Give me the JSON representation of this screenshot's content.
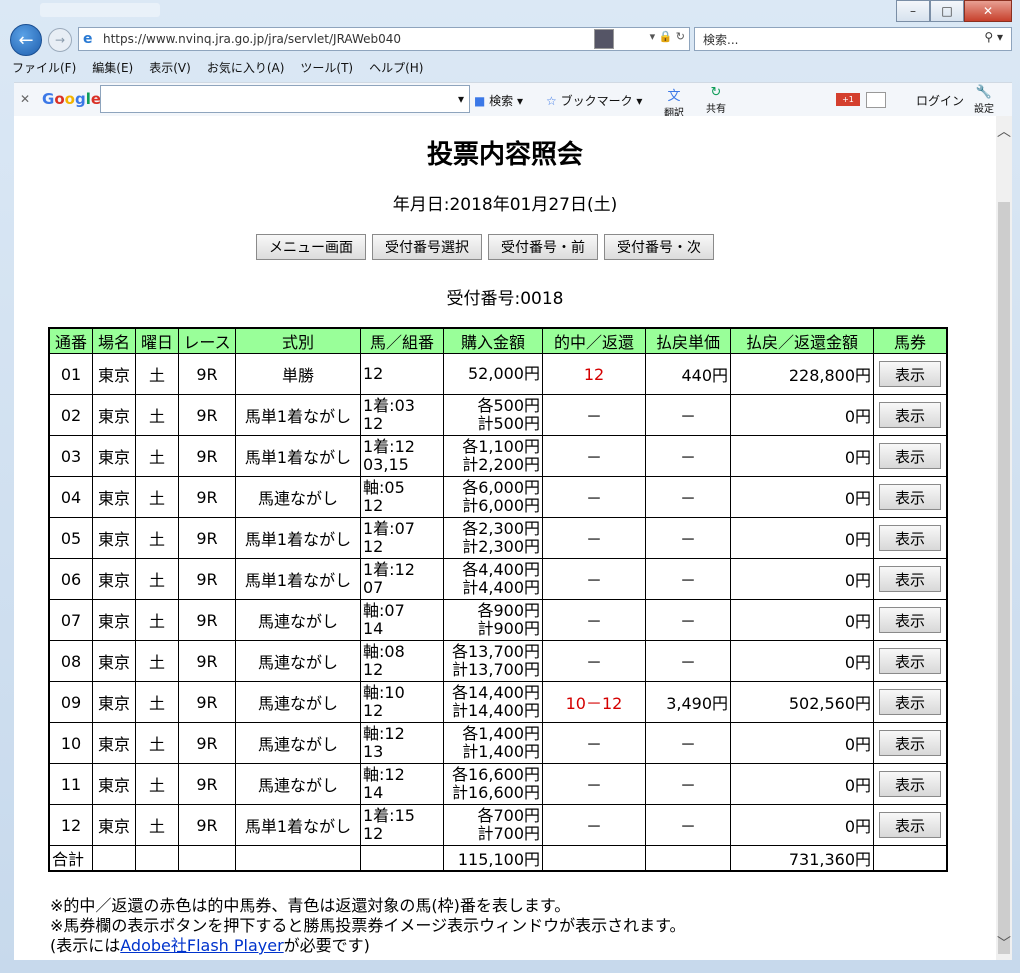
{
  "browser": {
    "url": "https://www.nvinq.jra.go.jp/jra/servlet/JRAWeb040",
    "search_placeholder": "検索...",
    "menu": [
      "ファイル(F)",
      "編集(E)",
      "表示(V)",
      "お気に入り(A)",
      "ツール(T)",
      "ヘルプ(H)"
    ],
    "google_bar": {
      "logo": "Google",
      "search_label": "検索",
      "bookmark_label": "ブックマーク",
      "translate_label": "翻訳",
      "share_label": "共有",
      "login_label": "ログイン",
      "settings_label": "設定",
      "gplus_label": "+1"
    }
  },
  "page": {
    "title": "投票内容照会",
    "date_line": "年月日:2018年01月27日(土)",
    "buttons": [
      "メニュー画面",
      "受付番号選択",
      "受付番号・前",
      "受付番号・次"
    ],
    "receipt_line": "受付番号:0018"
  },
  "table": {
    "headers": [
      "通番",
      "場名",
      "曜日",
      "レース",
      "式別",
      "馬／組番",
      "購入金額",
      "的中／返還",
      "払戻単価",
      "払戻／返還金額",
      "馬券"
    ],
    "rows": [
      {
        "no": "01",
        "venue": "東京",
        "day": "土",
        "race": "9R",
        "type": "単勝",
        "combo1": "12",
        "combo2": "",
        "amt1": "52,000円",
        "amt2": "",
        "hit": "12",
        "unit": "440円",
        "payout": "228,800円",
        "btn": "表示"
      },
      {
        "no": "02",
        "venue": "東京",
        "day": "土",
        "race": "9R",
        "type": "馬単1着ながし",
        "combo1": "1着:03",
        "combo2": "12",
        "amt1": "各500円",
        "amt2": "計500円",
        "hit": "－",
        "unit": "－",
        "payout": "0円",
        "btn": "表示"
      },
      {
        "no": "03",
        "venue": "東京",
        "day": "土",
        "race": "9R",
        "type": "馬単1着ながし",
        "combo1": "1着:12",
        "combo2": "03,15",
        "amt1": "各1,100円",
        "amt2": "計2,200円",
        "hit": "－",
        "unit": "－",
        "payout": "0円",
        "btn": "表示"
      },
      {
        "no": "04",
        "venue": "東京",
        "day": "土",
        "race": "9R",
        "type": "馬連ながし",
        "combo1": "軸:05",
        "combo2": "12",
        "amt1": "各6,000円",
        "amt2": "計6,000円",
        "hit": "－",
        "unit": "－",
        "payout": "0円",
        "btn": "表示"
      },
      {
        "no": "05",
        "venue": "東京",
        "day": "土",
        "race": "9R",
        "type": "馬単1着ながし",
        "combo1": "1着:07",
        "combo2": "12",
        "amt1": "各2,300円",
        "amt2": "計2,300円",
        "hit": "－",
        "unit": "－",
        "payout": "0円",
        "btn": "表示"
      },
      {
        "no": "06",
        "venue": "東京",
        "day": "土",
        "race": "9R",
        "type": "馬単1着ながし",
        "combo1": "1着:12",
        "combo2": "07",
        "amt1": "各4,400円",
        "amt2": "計4,400円",
        "hit": "－",
        "unit": "－",
        "payout": "0円",
        "btn": "表示"
      },
      {
        "no": "07",
        "venue": "東京",
        "day": "土",
        "race": "9R",
        "type": "馬連ながし",
        "combo1": "軸:07",
        "combo2": "14",
        "amt1": "各900円",
        "amt2": "計900円",
        "hit": "－",
        "unit": "－",
        "payout": "0円",
        "btn": "表示"
      },
      {
        "no": "08",
        "venue": "東京",
        "day": "土",
        "race": "9R",
        "type": "馬連ながし",
        "combo1": "軸:08",
        "combo2": "12",
        "amt1": "各13,700円",
        "amt2": "計13,700円",
        "hit": "－",
        "unit": "－",
        "payout": "0円",
        "btn": "表示"
      },
      {
        "no": "09",
        "venue": "東京",
        "day": "土",
        "race": "9R",
        "type": "馬連ながし",
        "combo1": "軸:10",
        "combo2": "12",
        "amt1": "各14,400円",
        "amt2": "計14,400円",
        "hit": "10－12",
        "unit": "3,490円",
        "payout": "502,560円",
        "btn": "表示"
      },
      {
        "no": "10",
        "venue": "東京",
        "day": "土",
        "race": "9R",
        "type": "馬連ながし",
        "combo1": "軸:12",
        "combo2": "13",
        "amt1": "各1,400円",
        "amt2": "計1,400円",
        "hit": "－",
        "unit": "－",
        "payout": "0円",
        "btn": "表示"
      },
      {
        "no": "11",
        "venue": "東京",
        "day": "土",
        "race": "9R",
        "type": "馬連ながし",
        "combo1": "軸:12",
        "combo2": "14",
        "amt1": "各16,600円",
        "amt2": "計16,600円",
        "hit": "－",
        "unit": "－",
        "payout": "0円",
        "btn": "表示"
      },
      {
        "no": "12",
        "venue": "東京",
        "day": "土",
        "race": "9R",
        "type": "馬単1着ながし",
        "combo1": "1着:15",
        "combo2": "12",
        "amt1": "各700円",
        "amt2": "計700円",
        "hit": "－",
        "unit": "－",
        "payout": "0円",
        "btn": "表示"
      }
    ],
    "total": {
      "label": "合計",
      "amount": "115,100円",
      "payout": "731,360円"
    }
  },
  "notes": {
    "line1": "※的中／返還の赤色は的中馬券、青色は返還対象の馬(枠)番を表します。",
    "line2": "※馬券欄の表示ボタンを押下すると勝馬投票券イメージ表示ウィンドウが表示されます。",
    "line3_pre": "(表示には",
    "line3_link": "Adobe社Flash Player",
    "line3_post": "が必要です)"
  },
  "colors": {
    "header_bg": "#99ff99",
    "hit_red": "#d40000",
    "link": "#0033cc"
  }
}
